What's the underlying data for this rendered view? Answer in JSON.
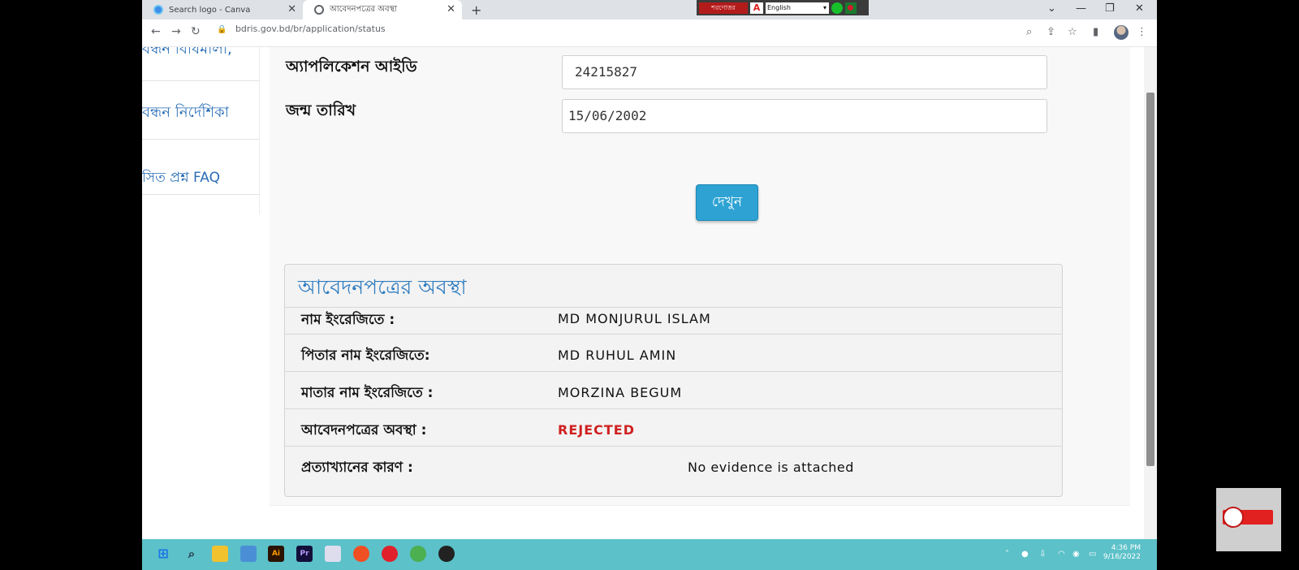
{
  "browser": {
    "tabs": [
      {
        "title": "Search logo - Canva",
        "active": false
      },
      {
        "title": "আবেদনপত্রের অবস্থা",
        "active": true
      }
    ],
    "url": "bdris.gov.bd/br/application/status",
    "extensions": {
      "red_label": "শরণোত্তর",
      "language": "English"
    }
  },
  "sidebar": {
    "items": [
      {
        "label": "বন্ধন বিধিমালা,"
      },
      {
        "label": "বন্ধন নির্দেশিকা"
      },
      {
        "label": "সিত প্রশ্ন FAQ"
      }
    ]
  },
  "form": {
    "application_id_label": "অ্যাপলিকেশন আইডি",
    "application_id_value": "24215827",
    "dob_label": "জন্ম তারিখ",
    "dob_value": "15/06/2002",
    "view_button": "দেখুন"
  },
  "status": {
    "title": "আবেদনপত্রের অবস্থা",
    "rows": [
      {
        "label": "নাম ইংরেজিতে :",
        "value": "MD MONJURUL ISLAM"
      },
      {
        "label": "পিতার নাম ইংরেজিতে:",
        "value": "MD RUHUL AMIN"
      },
      {
        "label": "মাতার নাম ইংরেজিতে :",
        "value": "MORZINA BEGUM"
      },
      {
        "label": "আবেদনপত্রের অবস্থা :",
        "value": "REJECTED",
        "status_color": "#d02020"
      },
      {
        "label": "প্রত্যাখ্যানের কারণ :",
        "value": "No evidence is attached"
      }
    ]
  },
  "taskbar": {
    "time": "4:36 PM",
    "date": "9/16/2022"
  },
  "colors": {
    "accent_blue": "#2f7cc0",
    "button_blue": "#2ea3d3",
    "rejected_red": "#d02020",
    "taskbar": "#5cc1c9"
  }
}
